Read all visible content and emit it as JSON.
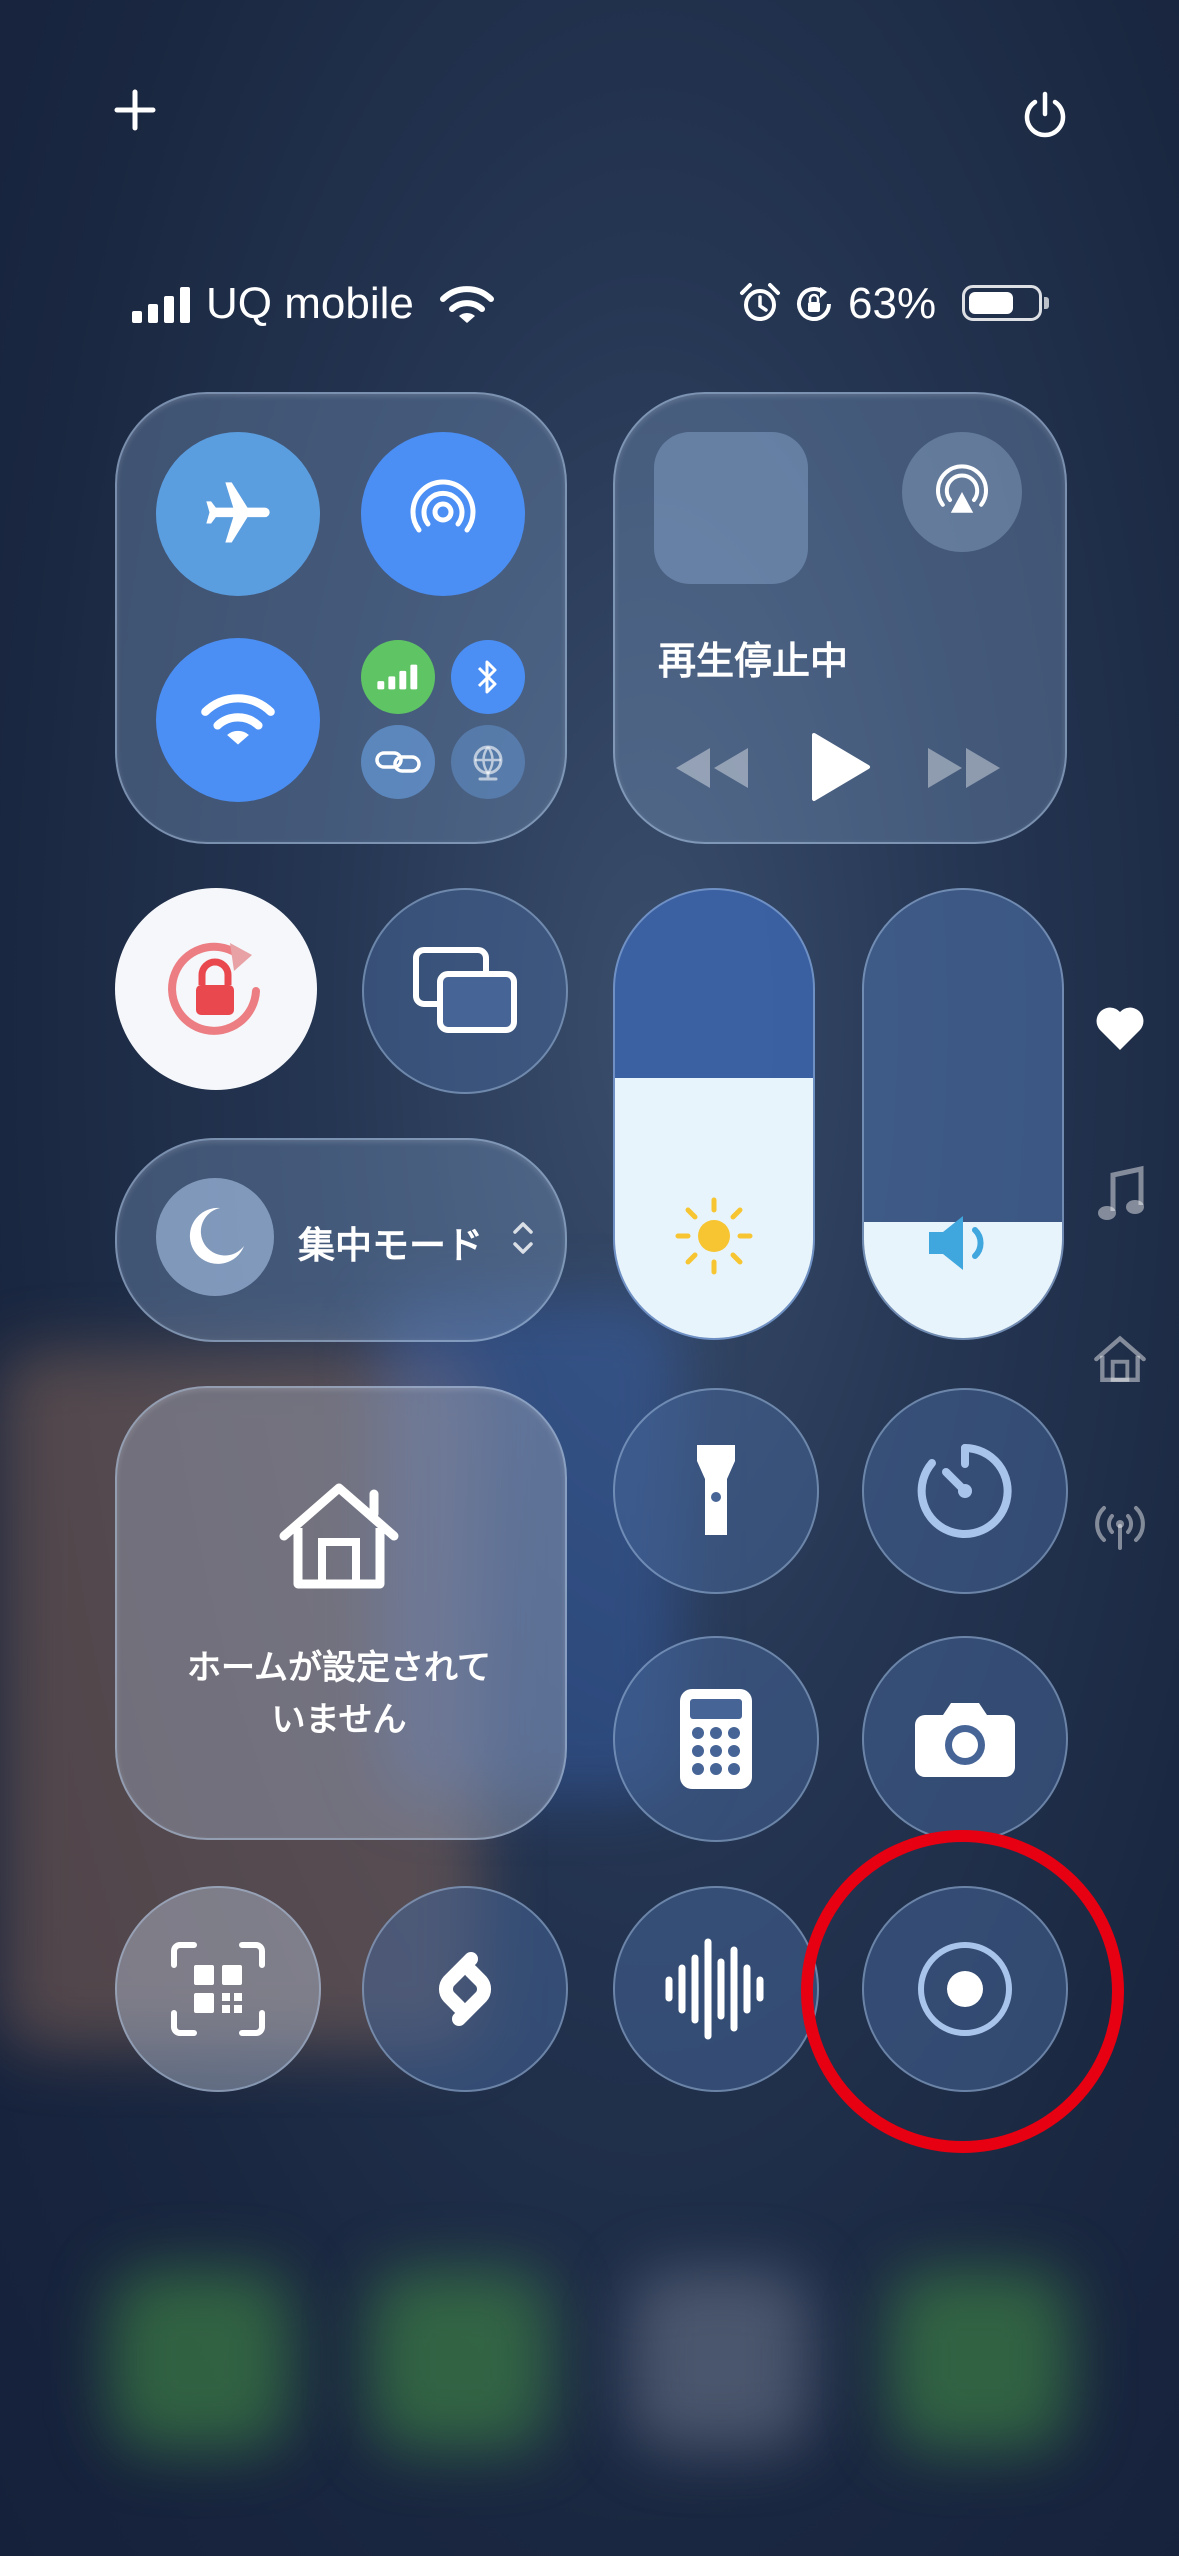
{
  "top": {
    "add_icon": "plus-icon",
    "power_icon": "power-icon"
  },
  "status": {
    "carrier": "UQ mobile",
    "battery": "63%"
  },
  "connectivity": {
    "airplane_icon": "airplane-icon",
    "airdrop_icon": "airdrop-icon",
    "wifi_icon": "wifi-icon",
    "cellular_icon": "cellular-icon",
    "bluetooth_icon": "bluetooth-icon",
    "hotspot_icon": "personal-hotspot-icon",
    "vpn_icon": "vpn-globe-icon"
  },
  "media": {
    "status": "再生停止中"
  },
  "focus": {
    "label": "集中モード"
  },
  "home": {
    "text_line1": "ホームが設定されて",
    "text_line2": "いません"
  },
  "sliders": {
    "brightness_level": 0.58,
    "volume_level": 0.26
  },
  "side_nav": [
    "heart-icon",
    "music-note-icon",
    "home-icon",
    "antenna-icon"
  ],
  "accent_colors": {
    "blue": "#4b8ff5",
    "green": "#5fc463",
    "highlight_ring": "#e60012",
    "lock_red": "#e8484e"
  }
}
